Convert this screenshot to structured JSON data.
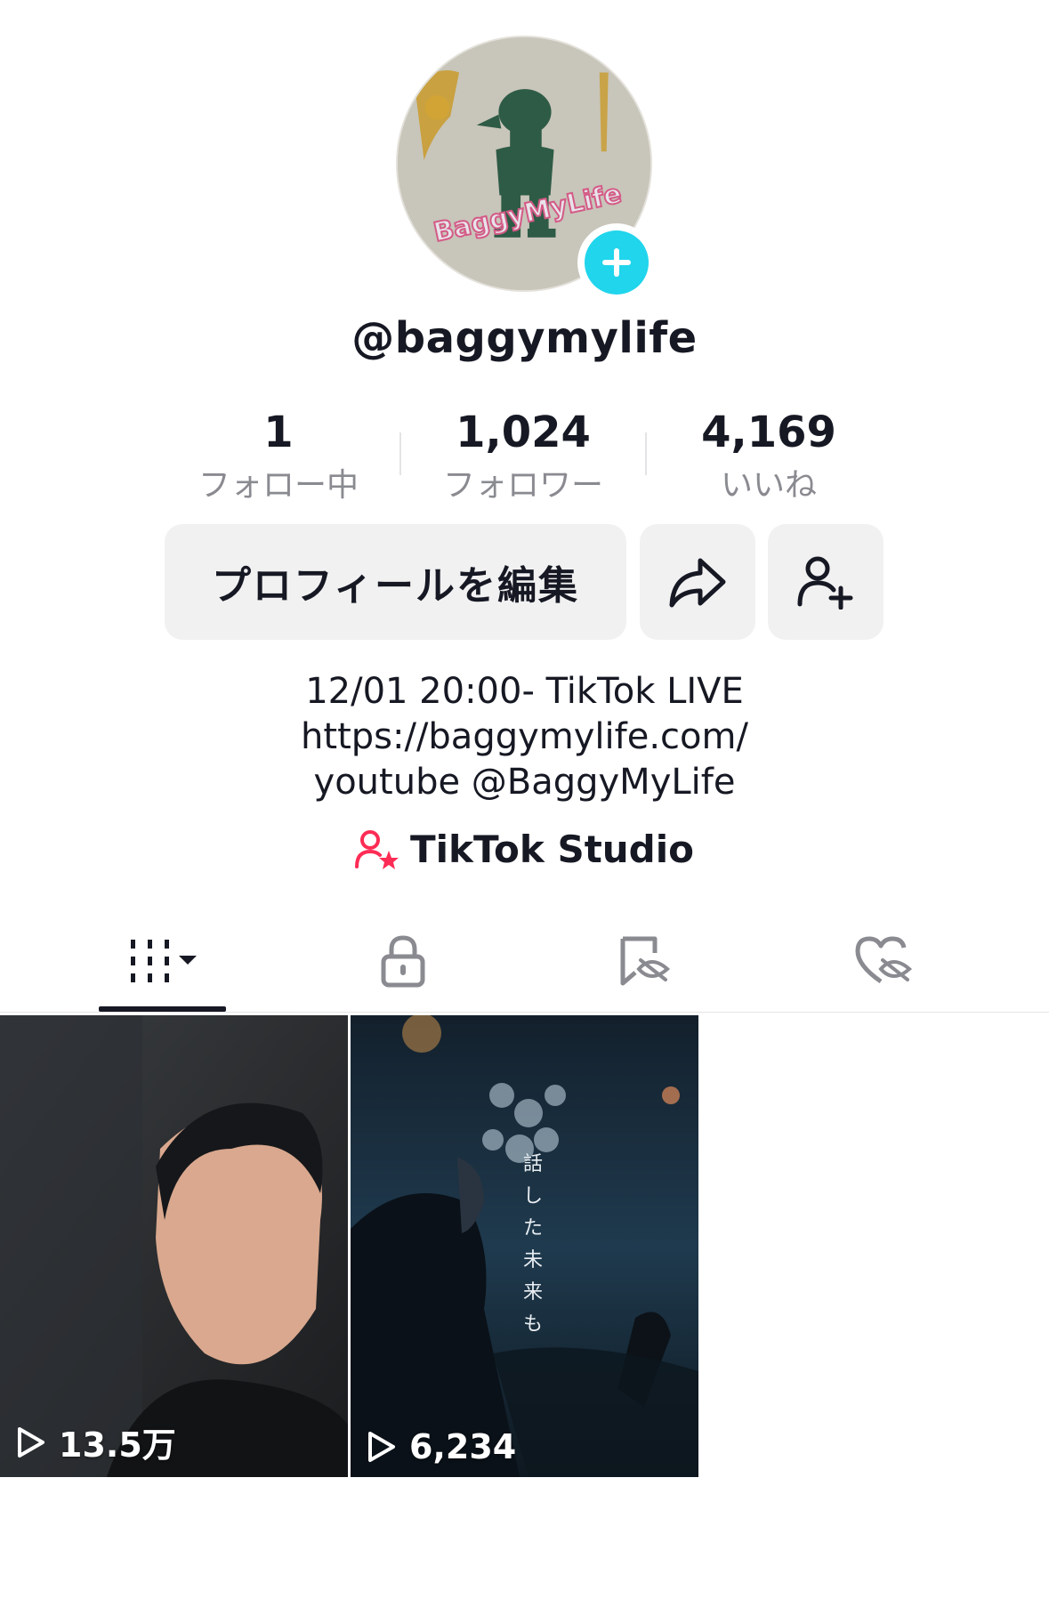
{
  "profile": {
    "avatar_text": "BaggyMyLife",
    "username": "@baggymylife"
  },
  "stats": [
    {
      "value": "1",
      "label": "フォロー中"
    },
    {
      "value": "1,024",
      "label": "フォロワー"
    },
    {
      "value": "4,169",
      "label": "いいね"
    }
  ],
  "actions": {
    "edit_label": "プロフィールを編集"
  },
  "bio": {
    "lines": [
      "12/01 20:00- TikTok LIVE",
      "https://baggymylife.com/",
      "youtube @BaggyMyLife"
    ]
  },
  "studio": {
    "label": "TikTok Studio"
  },
  "tabs": [
    {
      "icon": "videos-grid-icon",
      "active": true
    },
    {
      "icon": "lock-icon",
      "active": false
    },
    {
      "icon": "favorites-hidden-icon",
      "active": false
    },
    {
      "icon": "liked-hidden-icon",
      "active": false
    }
  ],
  "videos": [
    {
      "views": "13.5万",
      "overlay_text": ""
    },
    {
      "views": "6,234",
      "overlay_text": "話した未来も"
    }
  ],
  "colors": {
    "accent_cyan": "#20d5ec",
    "studio_pink": "#fe2c55",
    "text": "#161823",
    "muted": "#8a8b91",
    "button_bg": "#f1f1f2"
  }
}
